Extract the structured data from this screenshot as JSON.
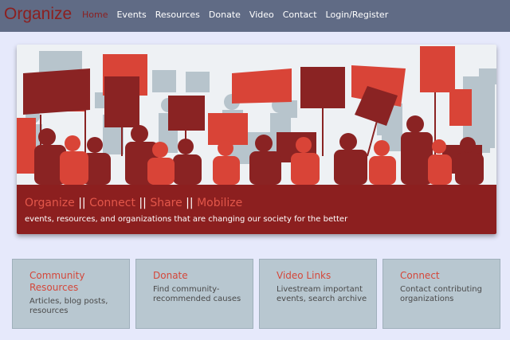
{
  "navbar": {
    "brand": "Organize",
    "links": [
      {
        "label": "Home",
        "active": true
      },
      {
        "label": "Events"
      },
      {
        "label": "Resources"
      },
      {
        "label": "Donate"
      },
      {
        "label": "Video"
      },
      {
        "label": "Contact"
      },
      {
        "label": "Login/Register"
      }
    ]
  },
  "hero": {
    "image": "protest-crowd-illustration",
    "tagline": {
      "words": [
        "Organize",
        "Connect",
        "Share",
        "Mobilize"
      ],
      "separator": "||"
    },
    "subtitle": "events, resources, and organizations that are changing our society for the better"
  },
  "cards": [
    {
      "title": "Community Resources",
      "body": "Articles, blog posts, resources"
    },
    {
      "title": "Donate",
      "body": "Find community-recommended causes"
    },
    {
      "title": "Video Links",
      "body": "Livestream important events, search archive"
    },
    {
      "title": "Connect",
      "body": "Contact contributing organizations"
    }
  ],
  "colors": {
    "navbar_bg": "#606b85",
    "brand": "#8c1f1f",
    "accent": "#e3574a",
    "card_bg": "#b8c7d0",
    "page_bg": "#e6e9fb"
  }
}
